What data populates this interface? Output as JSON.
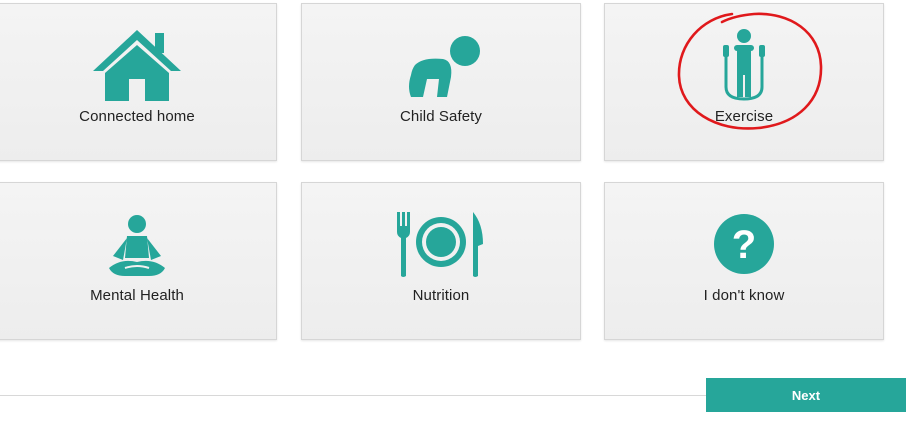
{
  "colors": {
    "accent": "#26a69a",
    "card_background": "#f1f1f1",
    "annotation": "#e0191c"
  },
  "options": [
    {
      "label": "Connected home",
      "icon": "house-icon"
    },
    {
      "label": "Child Safety",
      "icon": "crawling-baby-icon"
    },
    {
      "label": "Exercise",
      "icon": "jump-rope-icon"
    },
    {
      "label": "Mental Health",
      "icon": "meditation-icon"
    },
    {
      "label": "Nutrition",
      "icon": "plate-fork-knife-icon"
    },
    {
      "label": "I don't know",
      "icon": "question-mark-icon"
    }
  ],
  "annotation": {
    "circled_option": "Exercise",
    "style": "hand-drawn red circle"
  },
  "footer": {
    "next_label": "Next"
  }
}
